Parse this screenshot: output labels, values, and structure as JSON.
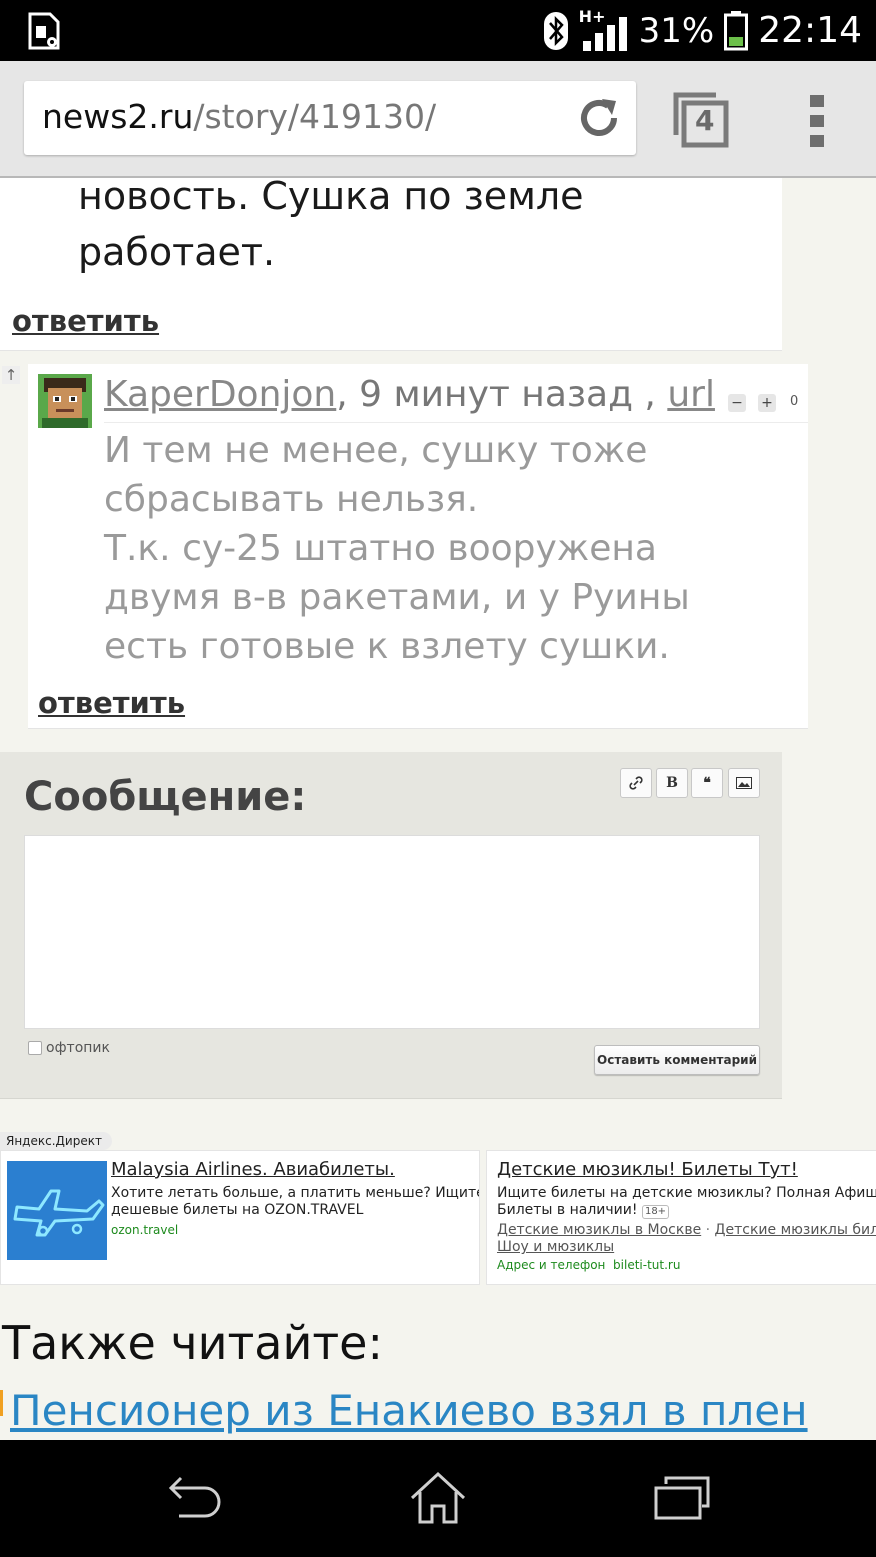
{
  "status_bar": {
    "network": "H+",
    "battery_percent": "31%",
    "time": "22:14",
    "icons": [
      "sim-settings-icon",
      "bluetooth-icon",
      "signal-icon",
      "battery-icon"
    ]
  },
  "browser": {
    "url_domain": "news2.ru",
    "url_path": "/story/419130/",
    "tab_count": "4",
    "icons": [
      "reload-icon",
      "tabs-icon",
      "overflow-menu-icon"
    ]
  },
  "comments": [
    {
      "text_lines": [
        "новость. Сушка по земле",
        "работает."
      ],
      "reply_label": "ответить"
    },
    {
      "author": "KaperDonjon",
      "time_ago": ", 9 минут назад , ",
      "url_label": "url",
      "vote_minus": "−",
      "vote_plus": "+",
      "score": "0",
      "body_lines": [
        "И тем не менее, сушку тоже",
        "сбрасывать нельзя.",
        "Т.к. су-25 штатно вооружена",
        "двумя в-в ракетами, и у Руины",
        "есть готовые к взлету сушки."
      ],
      "reply_label": "ответить"
    }
  ],
  "comment_form": {
    "title": "Сообщение:",
    "format_buttons": [
      "link-icon",
      "B",
      "quote-icon",
      "image-icon"
    ],
    "bold_label": "B",
    "quote_label": "❝",
    "offtopic_label": "офтопик",
    "submit_label": "Оставить комментарий"
  },
  "ads": {
    "label": "Яндекс.Директ",
    "items": [
      {
        "title": "Malaysia Airlines. Авиабилеты.",
        "text_lines": [
          "Хотите летать больше, а платить меньше? Ищите",
          "дешевые билеты на OZON.TRAVEL"
        ],
        "domain": "ozon.travel"
      },
      {
        "title": "Детские мюзиклы! Билеты Тут!",
        "text_lines": [
          "Ищите билеты на детские мюзиклы? Полная Афиша мю",
          "Билеты в наличии!"
        ],
        "age": "18+",
        "links": [
          "Детские мюзиклы в Москве",
          "Детские мюзиклы билеты",
          "Шоу и мюзиклы"
        ],
        "separator": "·",
        "contacts": "Адрес и телефон",
        "domain": "bileti-tut.ru"
      }
    ]
  },
  "also_read": {
    "heading": "Также читайте:",
    "first_link": "Пенсионер из Енакиево взял в плен"
  },
  "nav_bar": {
    "icons": [
      "back-icon",
      "home-icon",
      "recent-apps-icon"
    ]
  }
}
